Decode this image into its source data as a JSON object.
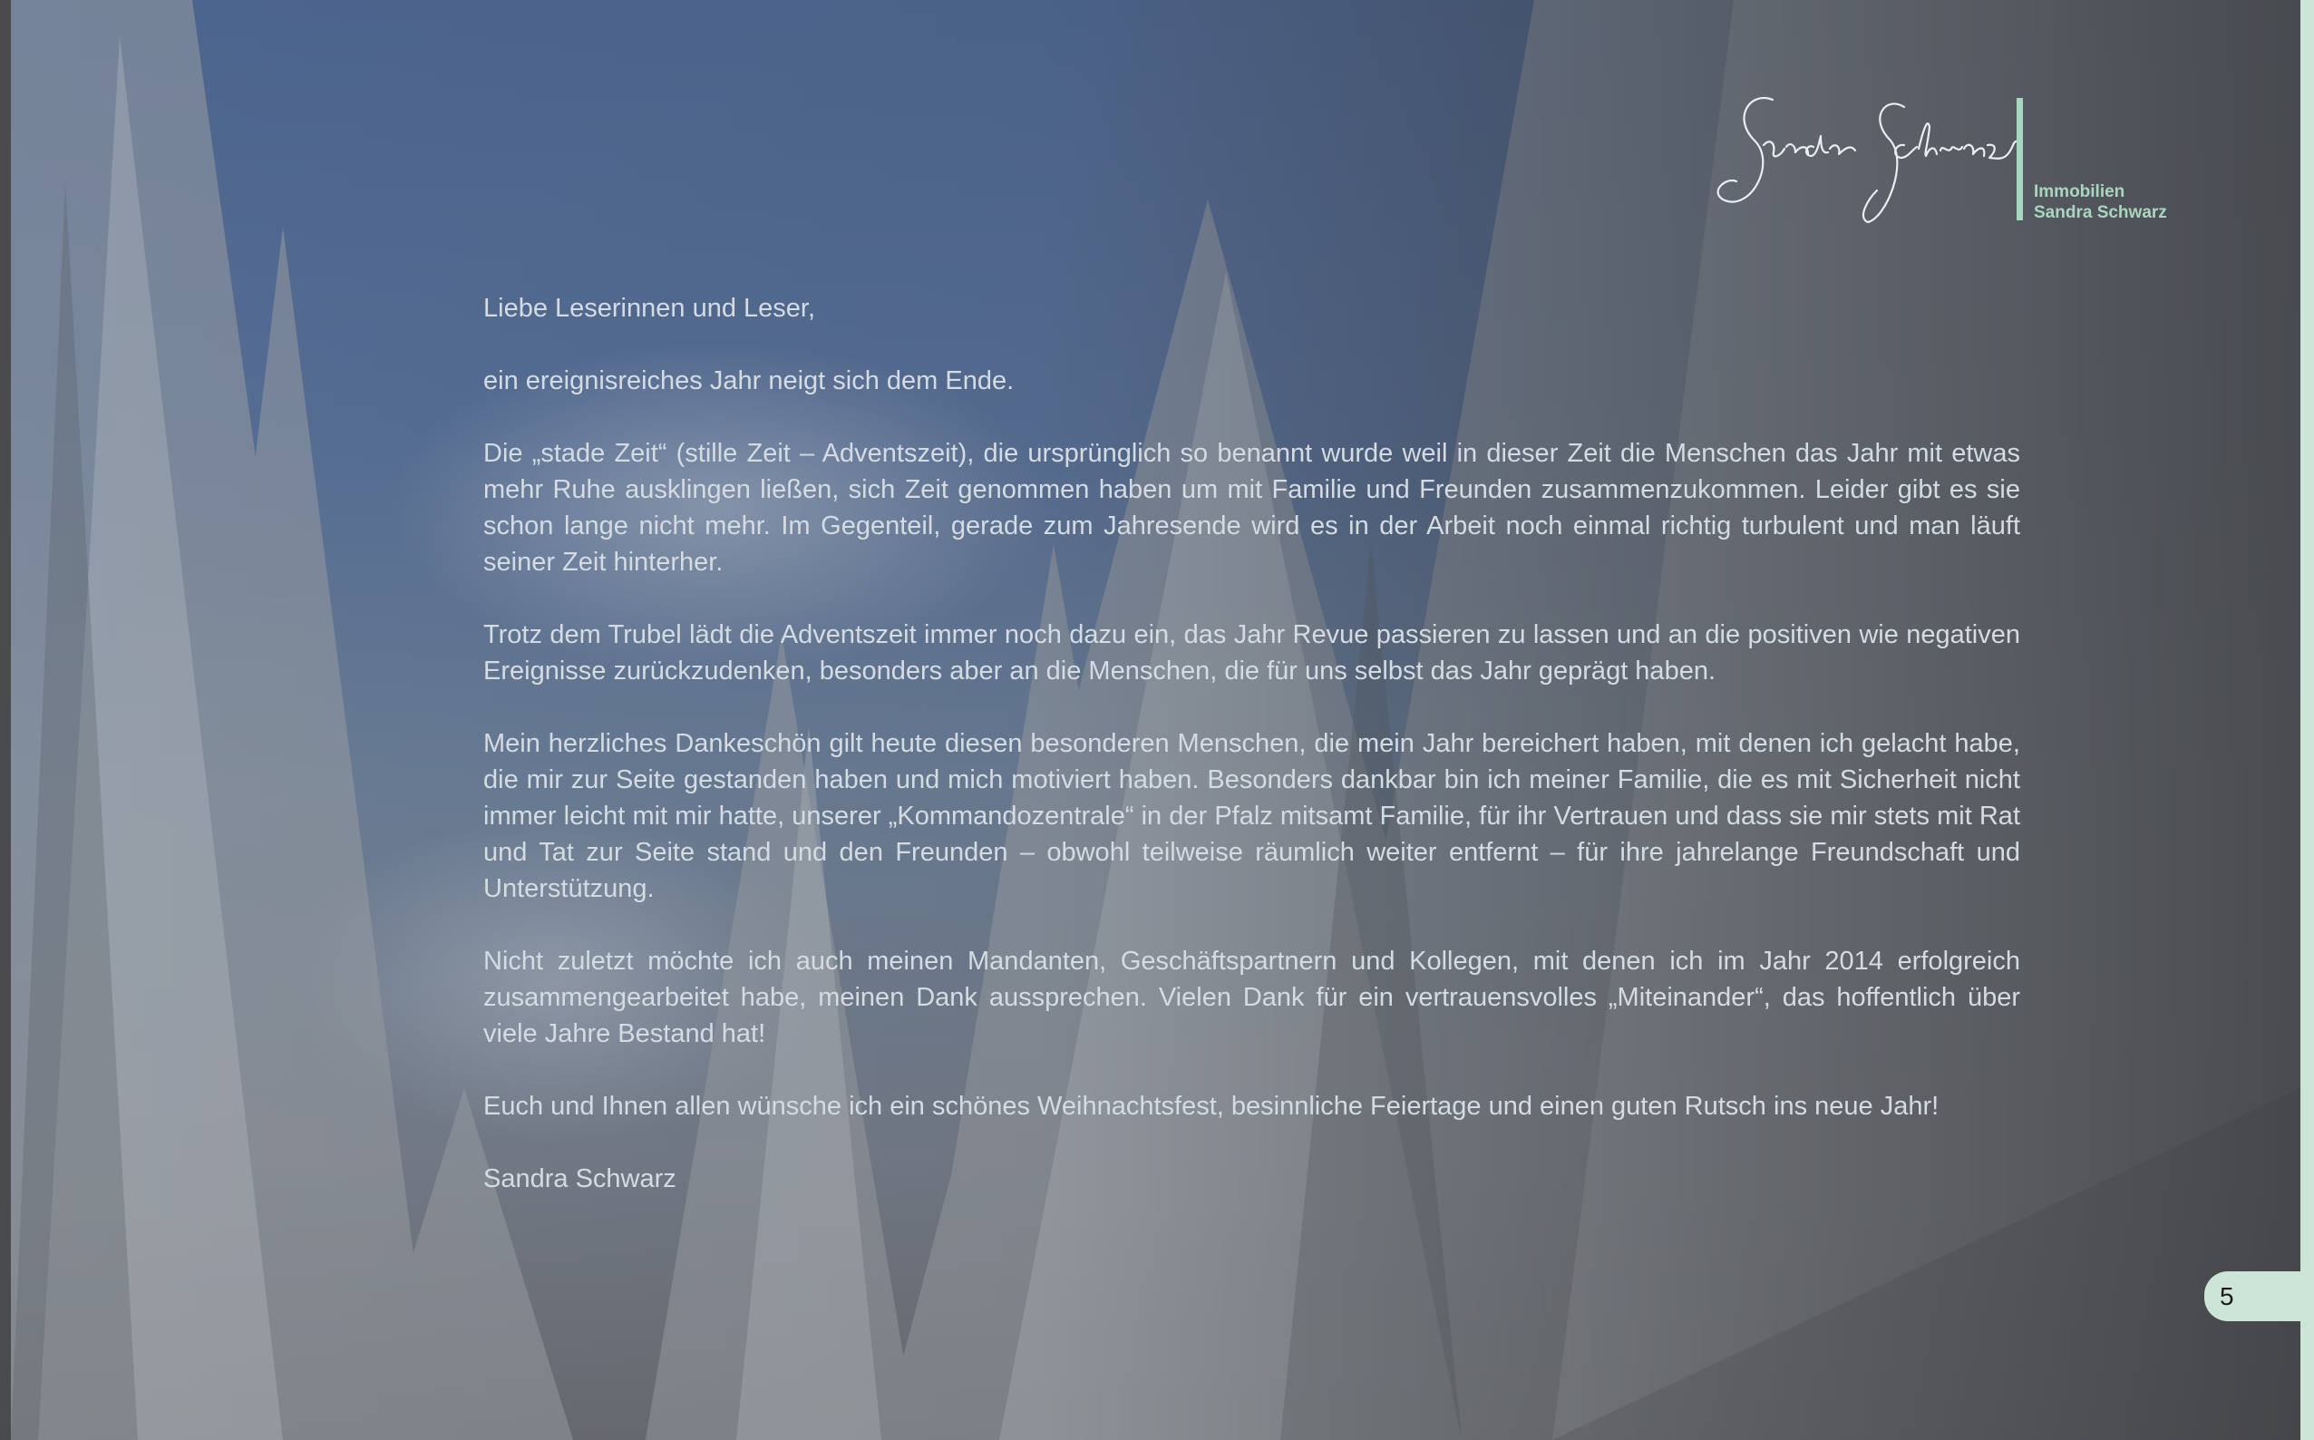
{
  "logo": {
    "signature": "Sandra Schwarz",
    "company_line1": "Immobilien",
    "company_line2": "Sandra Schwarz",
    "accent_color": "#a9d6bf"
  },
  "letter": {
    "salutation": "Liebe Leserinnen und Leser,",
    "paragraphs": [
      "ein ereignisreiches Jahr neigt sich dem Ende.",
      "Die „stade Zeit“ (stille Zeit – Adventszeit), die ursprünglich so benannt wurde weil in dieser Zeit die Menschen das Jahr mit etwas mehr Ruhe ausklingen ließen, sich Zeit genommen haben um mit Familie und Freunden zusammenzukommen. Leider gibt es sie schon lange nicht mehr. Im Gegenteil, gerade zum Jahresende wird es in der Arbeit noch einmal richtig turbulent und man läuft seiner Zeit hinterher.",
      "Trotz dem Trubel lädt die Adventszeit immer noch dazu ein, das Jahr Revue passieren zu lassen und an die positiven wie negativen Ereignisse zurückzudenken, besonders aber an die Menschen, die für uns selbst das Jahr geprägt haben.",
      "Mein herzliches Dankeschön gilt heute diesen besonderen Menschen, die mein Jahr bereichert haben, mit denen ich gelacht habe, die mir zur Seite gestanden haben und mich motiviert haben. Besonders dankbar bin ich meiner Familie, die es mit Sicherheit nicht immer leicht mit mir hatte, unserer „Kommandozentrale“ in der Pfalz mitsamt Familie, für ihr Vertrauen und dass sie mir stets mit Rat und Tat zur Seite stand und den Freunden – obwohl teilweise räumlich weiter entfernt – für ihre jahrelange Freundschaft und Unterstützung.",
      "Nicht zuletzt möchte ich auch meinen Mandanten, Geschäftspartnern und Kollegen, mit denen ich im Jahr 2014 erfolgreich zusammengearbeitet habe, meinen Dank aussprechen. Vielen Dank für ein vertrauensvolles „Miteinander“, das hoffentlich über viele Jahre Bestand hat!",
      "Euch und Ihnen allen wünsche ich ein schönes Weihnachtsfest, besinnliche Feiertage und einen guten Rutsch ins neue Jahr!"
    ],
    "signoff": "Sandra Schwarz",
    "text_color": "#d4dbe2"
  },
  "page_number": "5"
}
